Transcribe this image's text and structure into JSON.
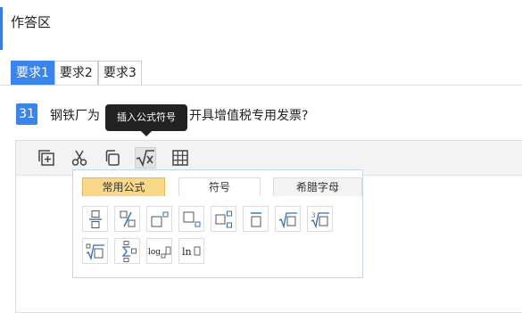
{
  "section": {
    "title": "作答区"
  },
  "tabs": [
    {
      "label": "要求1",
      "active": true
    },
    {
      "label": "要求2",
      "active": false
    },
    {
      "label": "要求3",
      "active": false
    }
  ],
  "question": {
    "number": "31",
    "text_left": "钢铁厂为",
    "text_right": "开具增值税专用发票?"
  },
  "toolbar": {
    "tooltip": "插入公式符号",
    "icons": [
      "add-box-icon",
      "scissors-icon",
      "copy-icon",
      "sqrt-x-icon",
      "table-grid-icon"
    ]
  },
  "symbol_panel": {
    "tabs": [
      {
        "label": "常用公式",
        "active": true
      },
      {
        "label": "符号",
        "active": false
      },
      {
        "label": "希腊字母",
        "active": false
      }
    ],
    "symbols_row1": [
      "fraction",
      "slash-fraction",
      "superscript",
      "subscript",
      "sub-superscript",
      "overline",
      "sqrt",
      "cube-root"
    ],
    "symbols_row2": [
      "nth-root",
      "summation",
      "log-base",
      "ln"
    ],
    "labels": {
      "log": "log",
      "ln": "ln",
      "cube_index": "3"
    }
  },
  "colors": {
    "accent": "#3a85ec",
    "active_tab": "#fbd889",
    "tooltip_bg": "#222222",
    "symbol_blue": "#2f6fb3"
  }
}
